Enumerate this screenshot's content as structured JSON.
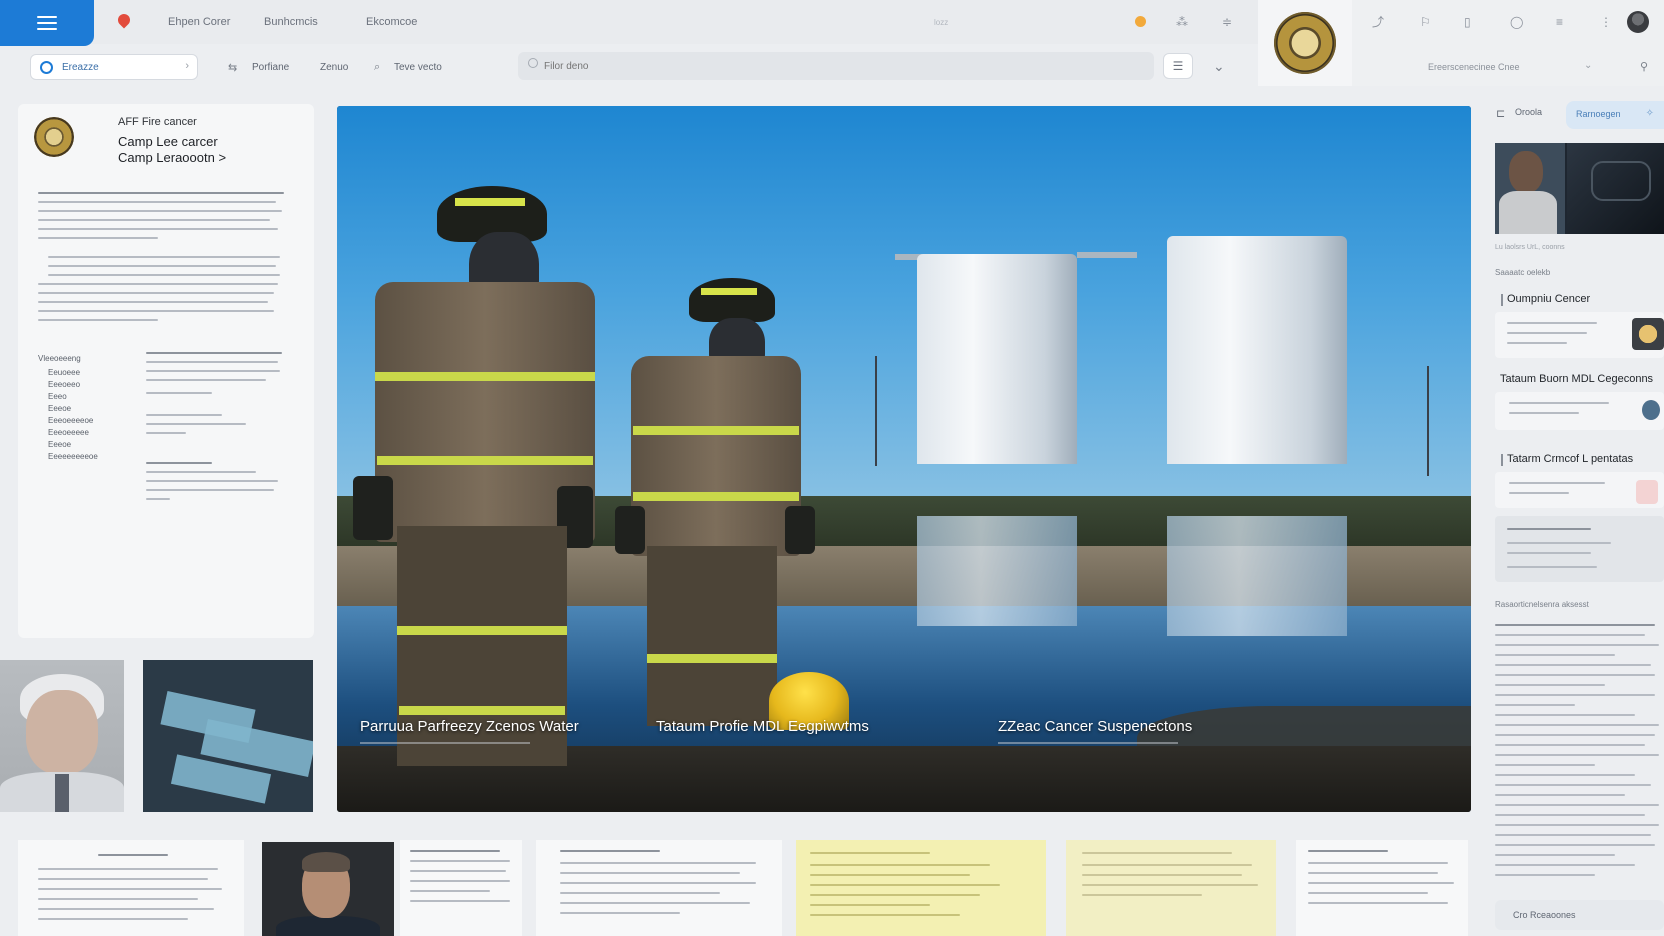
{
  "topbar": {
    "nav": [
      "Ehpen Corer",
      "Bunhcmcis",
      "Ekcomcoe"
    ],
    "center_text": "lozz"
  },
  "toolbar": {
    "breadcrumb": "Ereazze",
    "items": [
      "Porfiane",
      "Zenuo",
      "Teve vecto"
    ],
    "search_placeholder": "Filor deno",
    "right_filter": "Ereerscenecinee Cnee"
  },
  "document": {
    "title_line1": "AFF Fire cancer",
    "title_line2": "Camp Lee carcer",
    "title_line3": "Camp Leraoootn >",
    "section_label": "Vleeoeeeng",
    "left_list": [
      "Eeuoeee",
      "Eeeoeeo",
      "Eeeo",
      "Eeeoe",
      "Eeeoeeeeoe",
      "Eeeoeeeee",
      "Eeeoe",
      "Eeeeeeeeeoe"
    ]
  },
  "hero": {
    "captions": [
      "Parruua Parfreezy Zcenos Water",
      "Tataum Profie MDL Eegpiwvtms",
      "ZZeac Cancer Suspenectons"
    ]
  },
  "right_panel": {
    "tab_label": "Oroola",
    "active_tab": "Rarnoegen",
    "video_caption": "Lu laolsrs UrL, coonns",
    "section_label": "Saaaatc oelekb",
    "items": [
      {
        "title": "Oumpniu Cencer"
      },
      {
        "title": "Tataum Buorn MDL Cegeconns"
      },
      {
        "title": "Tatarm Crmcof L pentatas"
      }
    ],
    "footer_label": "Rasaorticnelsenra aksesst",
    "button_label": "Cro Rceaoones"
  },
  "colors": {
    "accent": "#1d7bd6",
    "accent_light": "#d9e7f5",
    "background": "#eceef1"
  },
  "icons": [
    "menu-icon",
    "pin-icon",
    "sun-icon",
    "seal-icon",
    "avatar-icon",
    "search-icon"
  ]
}
